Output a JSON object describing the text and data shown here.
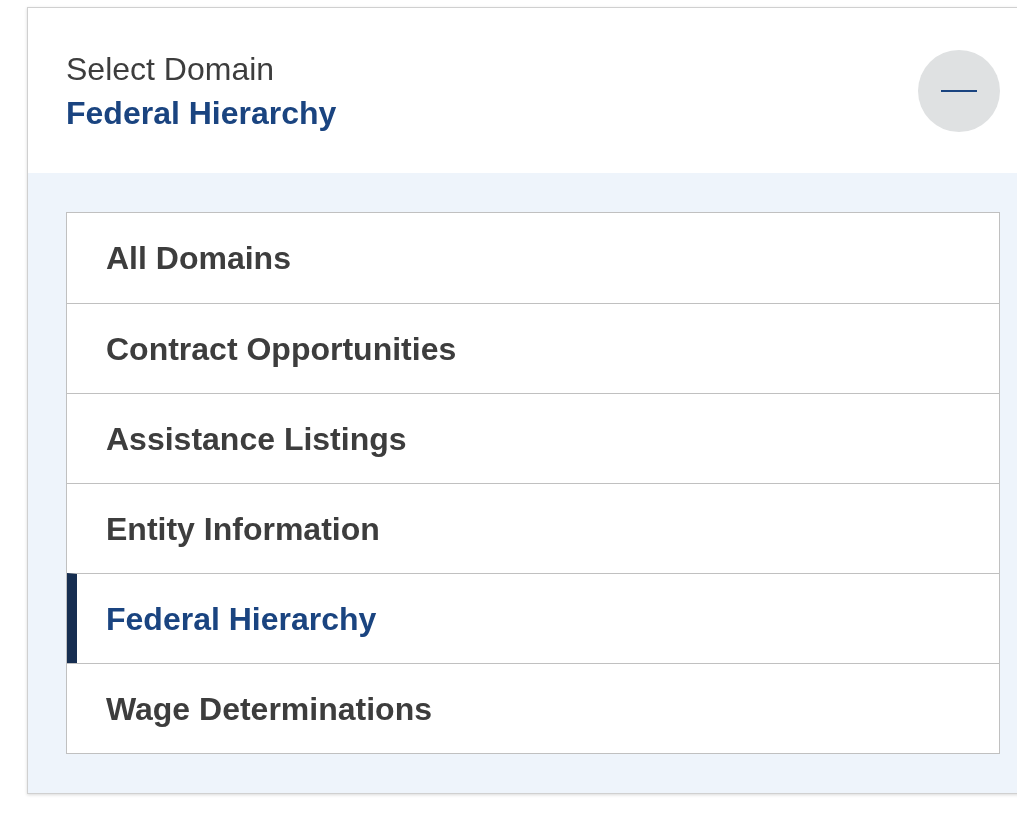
{
  "header": {
    "label": "Select Domain",
    "value": "Federal Hierarchy",
    "expanded": true
  },
  "domains": [
    {
      "label": "All Domains",
      "selected": false
    },
    {
      "label": "Contract Opportunities",
      "selected": false
    },
    {
      "label": "Assistance Listings",
      "selected": false
    },
    {
      "label": "Entity Information",
      "selected": false
    },
    {
      "label": "Federal Hierarchy",
      "selected": true
    },
    {
      "label": "Wage Determinations",
      "selected": false
    }
  ]
}
